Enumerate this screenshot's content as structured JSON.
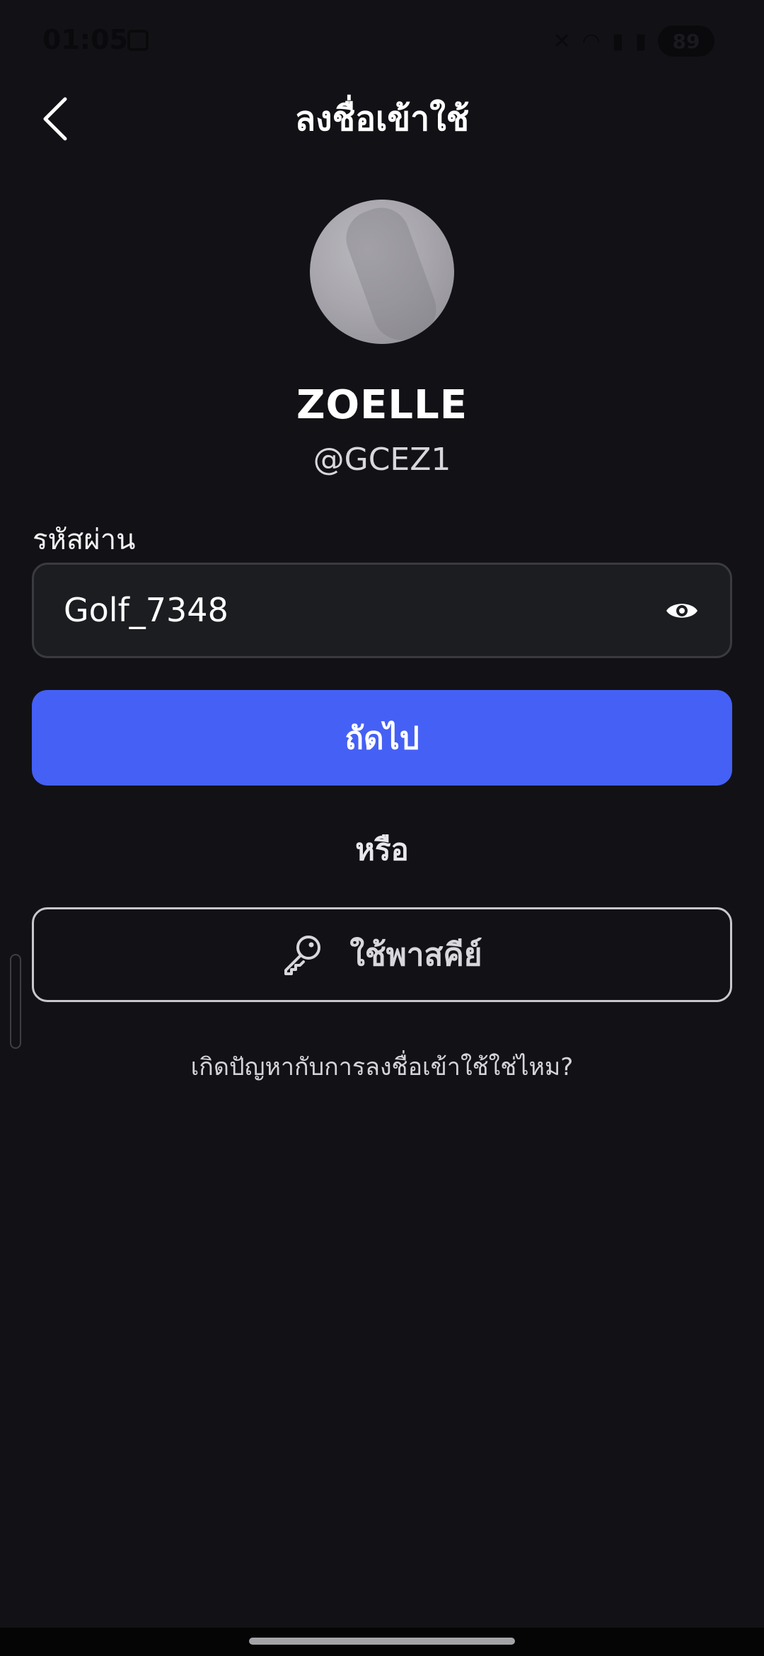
{
  "status_bar": {
    "time": "01:05",
    "battery": "89",
    "icons": [
      "mute-icon",
      "wifi-icon",
      "signal-icon",
      "signal-icon"
    ]
  },
  "header": {
    "title": "ลงชื่อเข้าใช้",
    "back_icon": "chevron-left-icon"
  },
  "profile": {
    "display_name": "ZOELLE",
    "handle": "@GCEZ1"
  },
  "password": {
    "label": "รหัสผ่าน",
    "value": "Golf_7348",
    "toggle_icon": "eye-icon"
  },
  "actions": {
    "next_label": "ถัดไป",
    "or_label": "หรือ",
    "passkey_label": "ใช้พาสคีย์",
    "passkey_icon": "key-icon",
    "trouble_label": "เกิดปัญหากับการลงชื่อเข้าใช้ใช่ไหม?"
  },
  "colors": {
    "background": "#121216",
    "primary_button": "#4560f5",
    "field_background": "#1c1d21"
  }
}
